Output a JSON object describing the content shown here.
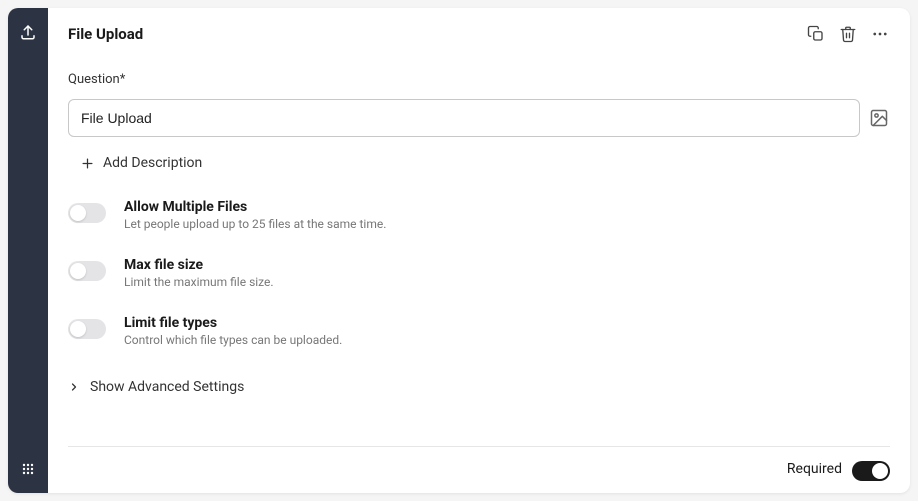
{
  "header": {
    "title": "File Upload"
  },
  "question": {
    "label": "Question*",
    "value": "File Upload"
  },
  "addDescription": {
    "label": "Add Description"
  },
  "options": {
    "allowMultiple": {
      "title": "Allow Multiple Files",
      "subtitle": "Let people upload up to 25 files at the same time.",
      "on": false
    },
    "maxSize": {
      "title": "Max file size",
      "subtitle": "Limit the maximum file size.",
      "on": false
    },
    "limitTypes": {
      "title": "Limit file types",
      "subtitle": "Control which file types can be uploaded.",
      "on": false
    }
  },
  "advanced": {
    "label": "Show Advanced Settings"
  },
  "footer": {
    "requiredLabel": "Required",
    "requiredOn": true
  }
}
